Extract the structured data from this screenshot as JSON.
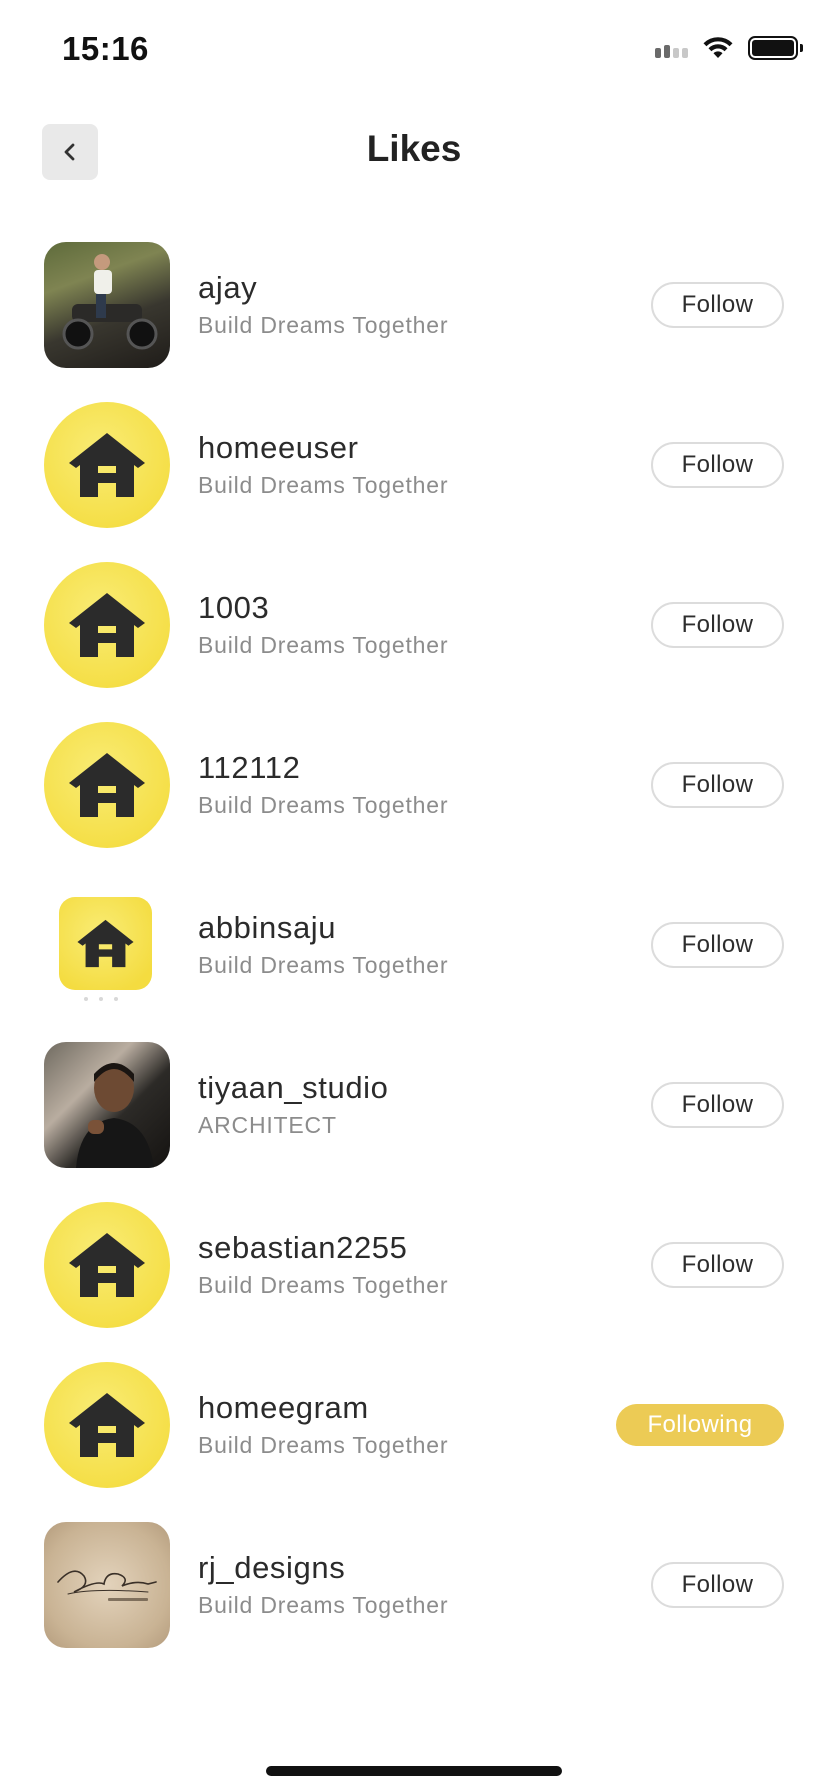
{
  "status_bar": {
    "time": "15:16"
  },
  "header": {
    "title": "Likes"
  },
  "likes": [
    {
      "username": "ajay",
      "subtitle": "Build Dreams Together",
      "avatar": "photo-rider",
      "button": "Follow",
      "following": false
    },
    {
      "username": "homeeuser",
      "subtitle": "Build Dreams Together",
      "avatar": "homee-logo",
      "button": "Follow",
      "following": false
    },
    {
      "username": "1003",
      "subtitle": "Build Dreams Together",
      "avatar": "homee-logo",
      "button": "Follow",
      "following": false
    },
    {
      "username": "112112",
      "subtitle": "Build Dreams Together",
      "avatar": "homee-logo",
      "button": "Follow",
      "following": false
    },
    {
      "username": "abbinsaju",
      "subtitle": "Build Dreams Together",
      "avatar": "homee-logo-small",
      "button": "Follow",
      "following": false
    },
    {
      "username": "tiyaan_studio",
      "subtitle": "ARCHITECT",
      "avatar": "photo-person",
      "button": "Follow",
      "following": false
    },
    {
      "username": "sebastian2255",
      "subtitle": "Build Dreams Together",
      "avatar": "homee-logo",
      "button": "Follow",
      "following": false
    },
    {
      "username": "homeegram",
      "subtitle": "Build Dreams Together",
      "avatar": "homee-logo",
      "button": "Following",
      "following": true
    },
    {
      "username": "rj_designs",
      "subtitle": "Build Dreams Together",
      "avatar": "photo-signature",
      "button": "Follow",
      "following": false
    }
  ],
  "colors": {
    "accent": "#eccb55",
    "logo_yellow": "#f5df48",
    "logo_dark": "#2b2b2b"
  }
}
